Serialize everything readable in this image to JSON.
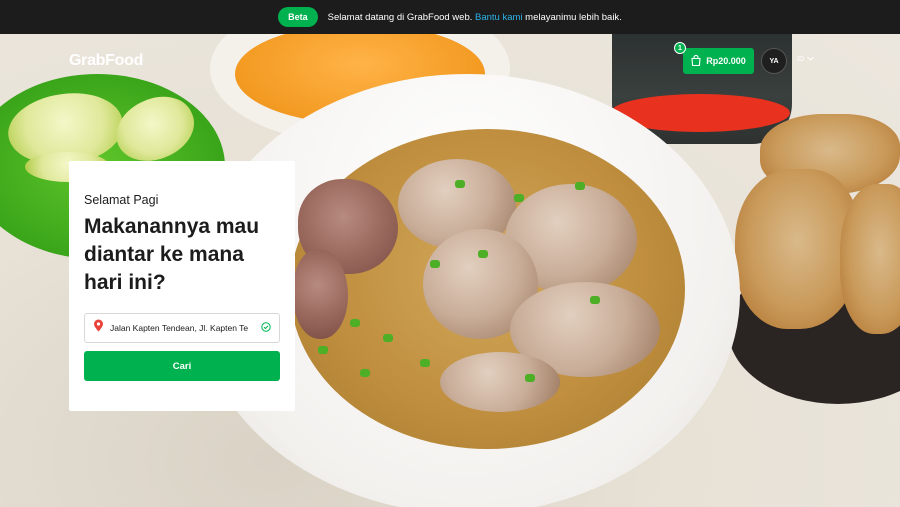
{
  "banner": {
    "badge": "Beta",
    "message": "Selamat datang di GrabFood web. ",
    "link": "Bantu kami",
    "message_end": " melayanimu lebih baik."
  },
  "header": {
    "logo": "GrabFood",
    "cart_badge": "1",
    "cart_amount": "Rp20.000",
    "avatar_initials": "YA",
    "language": "ID"
  },
  "card": {
    "greeting": "Selamat Pagi",
    "headline": "Makanannya mau diantar ke mana hari ini?",
    "location_value": "Jalan Kapten Tendean, Jl. Kapten Te",
    "search_button": "Cari"
  },
  "colors": {
    "brand_green": "#00b14f",
    "banner_bg": "#1c1c1c",
    "link_blue": "#2cb3e8",
    "pin_red": "#e8423a"
  },
  "icons": {
    "cart": "shopping-bag-icon",
    "language": "chevron-down-icon",
    "location": "location-pin-icon",
    "confirm": "check-circle-icon"
  }
}
